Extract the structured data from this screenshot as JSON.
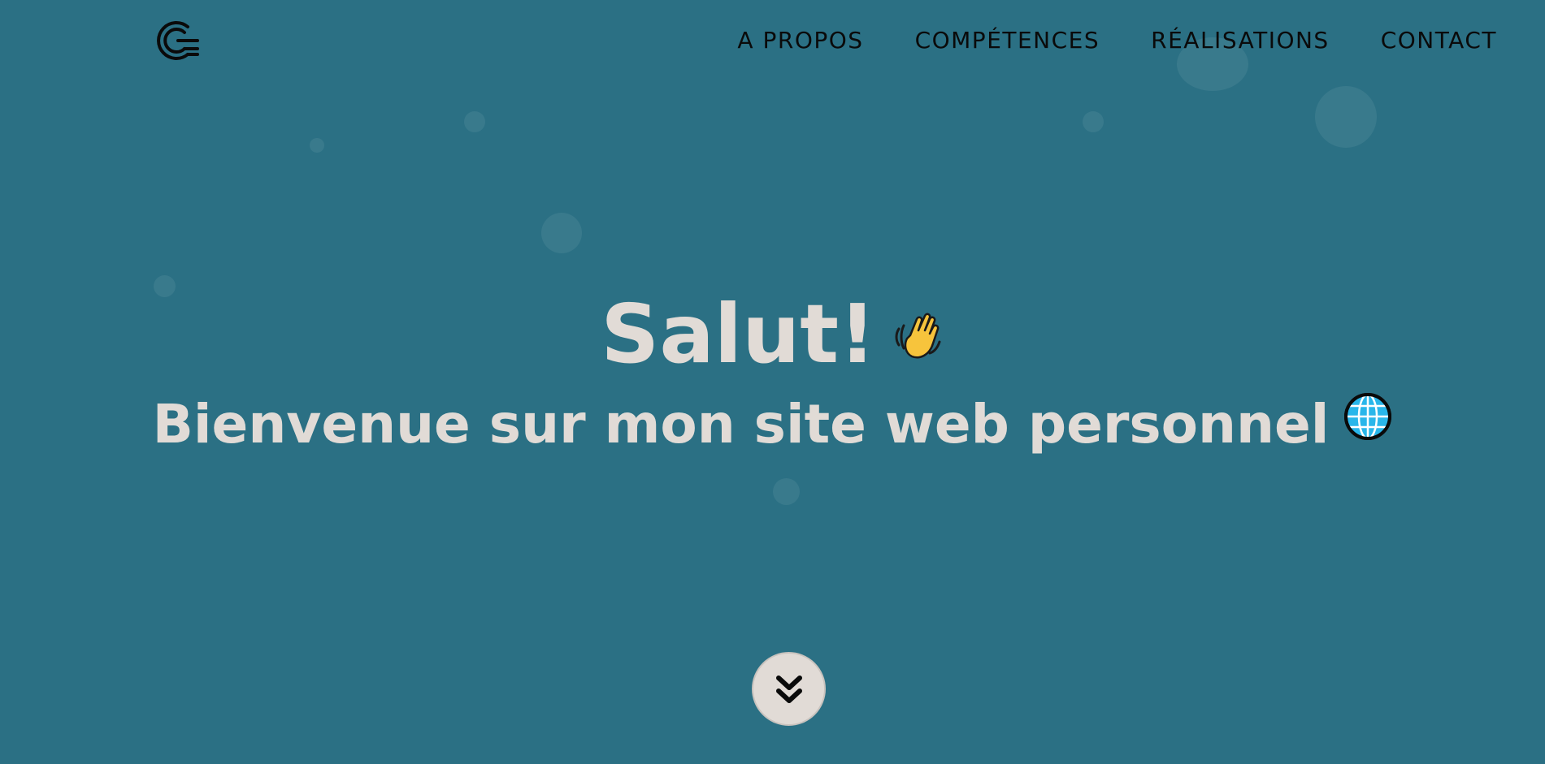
{
  "nav": {
    "items": [
      {
        "label": "A PROPOS"
      },
      {
        "label": "COMPÉTENCES"
      },
      {
        "label": "RÉALISATIONS"
      },
      {
        "label": "CONTACT"
      }
    ]
  },
  "hero": {
    "title": "Salut!",
    "subtitle": "Bienvenue sur mon site web personnel",
    "title_emoji_icon": "waving-hand-icon",
    "subtitle_emoji_icon": "globe-icon"
  },
  "scroll": {
    "icon": "double-chevron-down-icon"
  },
  "colors": {
    "background": "#2b7084",
    "text_light": "#e1dbd6",
    "nav_text": "#0a0a0a",
    "button_bg": "#e1dbd6"
  }
}
